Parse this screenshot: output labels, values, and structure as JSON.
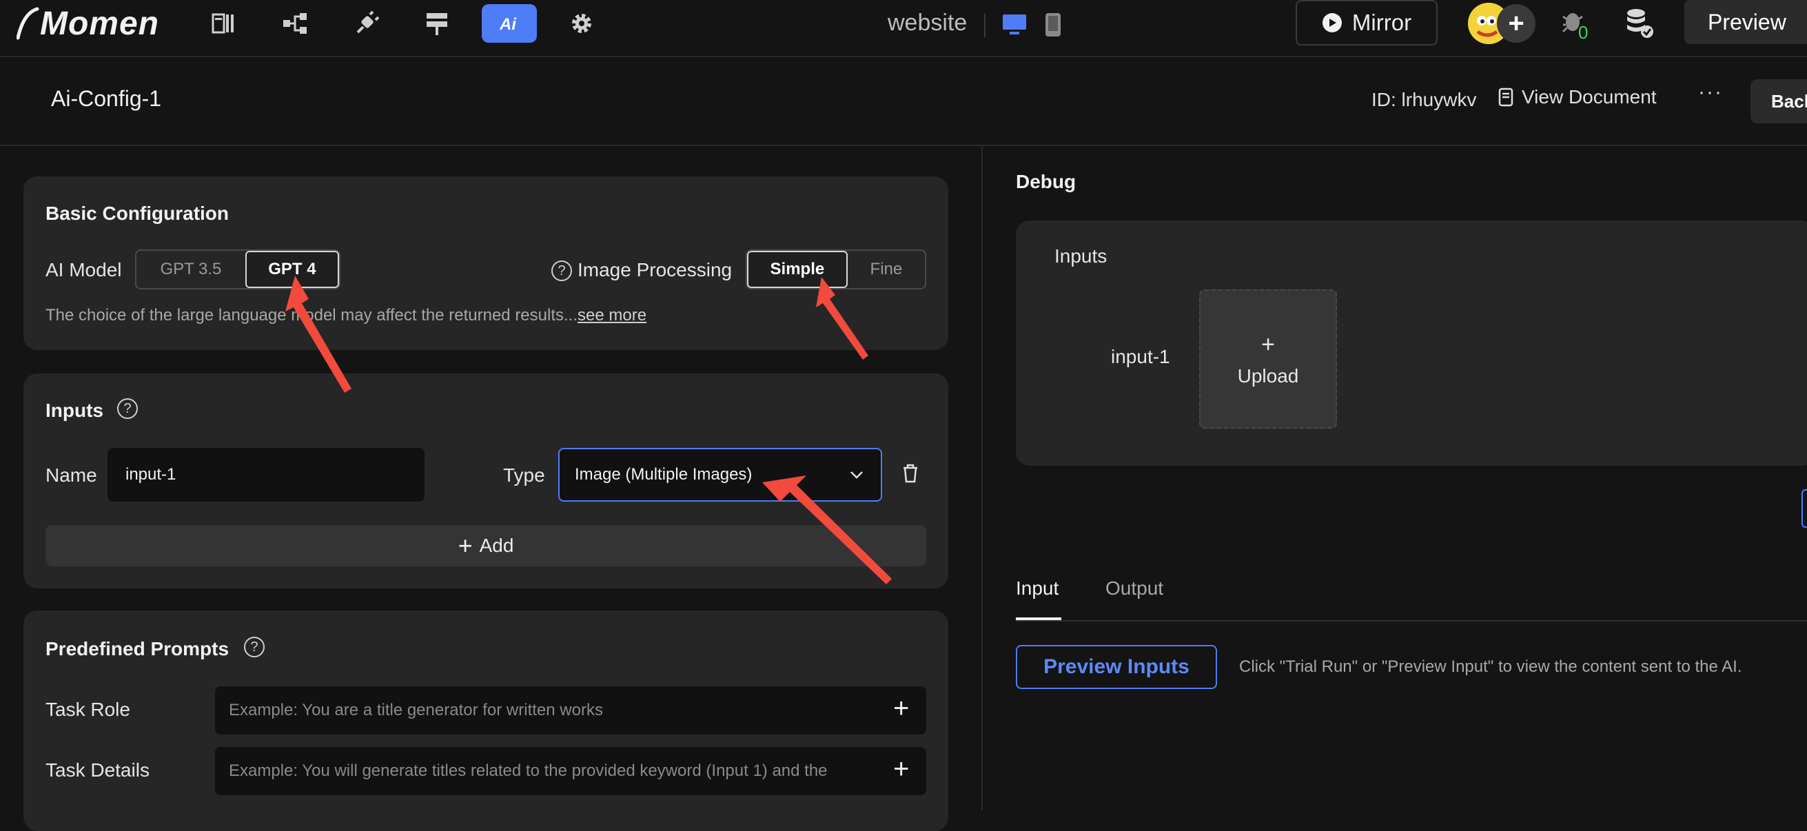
{
  "topbar": {
    "logo_text": "Momen",
    "site_name": "website",
    "mirror_label": "Mirror",
    "notif_count": "0",
    "avatar_add": "+",
    "preview_label": "Preview",
    "tool_icons": [
      "pages-icon",
      "tree-icon",
      "plugin-icon",
      "data-icon",
      "ai-icon",
      "settings-icon"
    ]
  },
  "subheader": {
    "config_title": "Ai-Config-1",
    "id_label": "ID: lrhuywkv",
    "view_document": "View Document",
    "more": "···",
    "back": "Back"
  },
  "basic_config": {
    "title": "Basic Configuration",
    "ai_model_label": "AI Model",
    "models": [
      "GPT 3.5",
      "GPT 4"
    ],
    "selected_model": "GPT 4",
    "image_processing_label": "Image Processing",
    "processing_options": [
      "Simple",
      "Fine"
    ],
    "selected_processing": "Simple",
    "hint": "The choice of the large language model may affect the returned results...",
    "see_more": "see more"
  },
  "inputs_section": {
    "title": "Inputs",
    "name_label": "Name",
    "name_value": "input-1",
    "type_label": "Type",
    "type_value": "Image (Multiple Images)",
    "add_label": "Add"
  },
  "prompts_section": {
    "title": "Predefined Prompts",
    "task_role_label": "Task Role",
    "task_role_placeholder": "Example: You are a title generator for written works",
    "task_details_label": "Task Details",
    "task_details_placeholder": "Example: You will generate titles related to the provided keyword (Input 1) and the"
  },
  "debug": {
    "title": "Debug",
    "inputs_title": "Inputs",
    "input_name": "input-1",
    "upload_plus": "+",
    "upload_label": "Upload",
    "tabs": [
      "Input",
      "Output"
    ],
    "active_tab": "Input",
    "preview_inputs_label": "Preview Inputs",
    "info_text": "Click \"Trial Run\" or \"Preview Input\" to view the content sent to the AI."
  },
  "colors": {
    "accent": "#4f7cf7",
    "background": "#141414",
    "panel": "#262626",
    "annotation_arrow": "#f24a3d"
  }
}
